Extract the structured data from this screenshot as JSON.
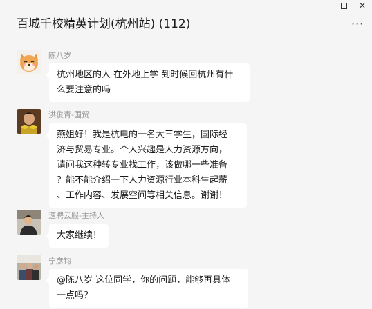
{
  "window": {
    "title": "百城千校精英计划(杭州站) (112)",
    "controls": {
      "minimize": "—",
      "close": "✕"
    },
    "more_label": "···"
  },
  "messages": [
    {
      "sender": "陈八岁",
      "avatar_icon": "dog-avatar-icon",
      "lines": [
        "杭州地区的人 在外地上学 到时候回杭州有什",
        "么要注意的吗"
      ]
    },
    {
      "sender": "洪俊青-国贸",
      "avatar_icon": "photo-avatar-icon",
      "lines": [
        "燕姐好！我是杭电的一名大三学生，国际经",
        "济与贸易专业。个人兴趣是人力资源方向，",
        "请问我这种转专业找工作，该做哪一些准备",
        "？能不能介绍一下人力资源行业本科生起薪",
        "、工作内容、发展空间等相关信息。谢谢！"
      ]
    },
    {
      "sender": "速聘云服-主持人",
      "avatar_icon": "person-avatar-icon",
      "lines": [
        "大家继续！"
      ]
    },
    {
      "sender": "宁彦钧",
      "avatar_icon": "group-photo-avatar-icon",
      "lines": [
        "@陈八岁 这位同学，你的问题，能够再具体",
        "一点吗？"
      ]
    }
  ]
}
